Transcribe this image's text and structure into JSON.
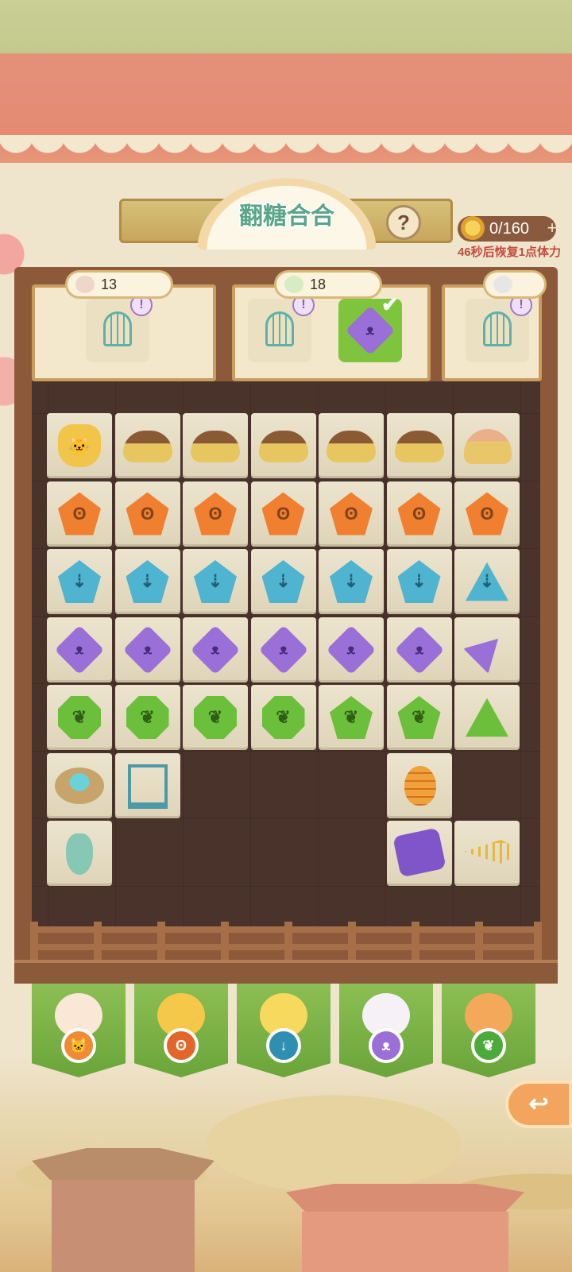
{
  "game": {
    "title": "翻糖合合",
    "help_label": "?",
    "energy": "0/160",
    "energy_plus": "+",
    "recover_text": "46秒后恢复1点体力"
  },
  "orders": [
    {
      "count": "13",
      "icon": "feather-icon",
      "slots": [
        {
          "icon": "cage-icon",
          "done": false,
          "info": "!"
        }
      ]
    },
    {
      "count": "18",
      "icon": "radish-icon",
      "slots": [
        {
          "icon": "cage-icon",
          "done": false,
          "info": "!"
        },
        {
          "icon": "rabbit-gem-icon",
          "done": true,
          "check": "✔"
        }
      ]
    },
    {
      "count": "",
      "icon": "eraser-icon",
      "slots": [
        {
          "icon": "cage-icon",
          "done": false,
          "info": "!"
        }
      ]
    }
  ],
  "board": {
    "rows": [
      [
        "cat-gem",
        "cat-food-bowl-fish",
        "cat-food-bowl-fish",
        "cat-food-bowl",
        "cat-food-bowl",
        "cat-food-bowl",
        "cat-food-can"
      ],
      [
        "bee-gem",
        "bee-gem",
        "bee-gem",
        "bee-gem",
        "bee-gem",
        "bee-gem",
        "bee-gem"
      ],
      [
        "bird-gem",
        "bird-gem",
        "bird-gem",
        "bird-gem",
        "bird-gem",
        "bird-gem",
        "bird-triangle"
      ],
      [
        "rabbit-gem",
        "rabbit-gem",
        "rabbit-gem",
        "rabbit-gem",
        "rabbit-gem",
        "rabbit-gem",
        "rabbit-triangle"
      ],
      [
        "paw-gem",
        "paw-gem",
        "paw-gem",
        "paw-gem",
        "paw-pentagon",
        "paw-pentagon",
        "paw-triangle"
      ],
      [
        "bird-nest",
        "bird-trap",
        "",
        "",
        "",
        "beehive",
        ""
      ],
      [
        "gourd",
        "",
        "",
        "",
        "",
        "magic-scroll",
        "fishbone"
      ]
    ]
  },
  "characters": [
    {
      "name": "cat",
      "badge": "cat-icon",
      "color": "#f08a34"
    },
    {
      "name": "bee",
      "badge": "bee-icon",
      "color": "#e4652a"
    },
    {
      "name": "chick",
      "badge": "arrow-down-icon",
      "color": "#2f8fb0"
    },
    {
      "name": "rabbit",
      "badge": "rabbit-icon",
      "color": "#9b6fd8"
    },
    {
      "name": "dog",
      "badge": "paw-icon",
      "color": "#4caa3a"
    }
  ],
  "back_label": "↩"
}
